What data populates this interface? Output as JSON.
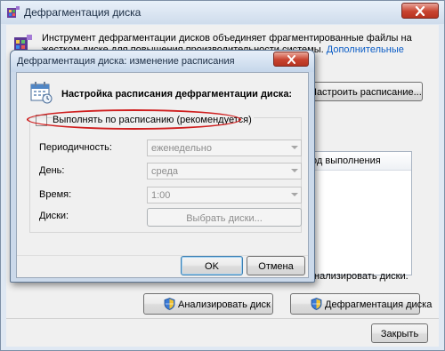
{
  "main_window": {
    "title": "Дефрагментация диска",
    "intro_text": "Инструмент дефрагментации дисков объединяет фрагментированные файлы на жестком диске для повышения производительности системы.",
    "intro_link": "Дополнительные сведения о дефрагментации дисков.",
    "schedule_button": "Настроить расписание...",
    "list_header_partial": "од выполнения",
    "analyze_caption_partial": "нализировать диски.",
    "analyze_button": "Анализировать диск",
    "defrag_button": "Дефрагментация диска",
    "close_button": "Закрыть"
  },
  "dialog": {
    "title": "Дефрагментация диска: изменение расписания",
    "heading": "Настройка расписания дефрагментации диска:",
    "checkbox_label": "Выполнять по расписанию (рекомендуется)",
    "checkbox_checked": false,
    "fields": {
      "frequency_label": "Периодичность:",
      "frequency_value": "еженедельно",
      "day_label": "День:",
      "day_value": "среда",
      "time_label": "Время:",
      "time_value": "1:00",
      "disks_label": "Диски:",
      "disks_button": "Выбрать диски..."
    },
    "ok_button": "OK",
    "cancel_button": "Отмена"
  },
  "colors": {
    "link": "#0b5dc6",
    "highlight_ellipse": "#cf1f1f",
    "close_button": "#c8432f"
  }
}
